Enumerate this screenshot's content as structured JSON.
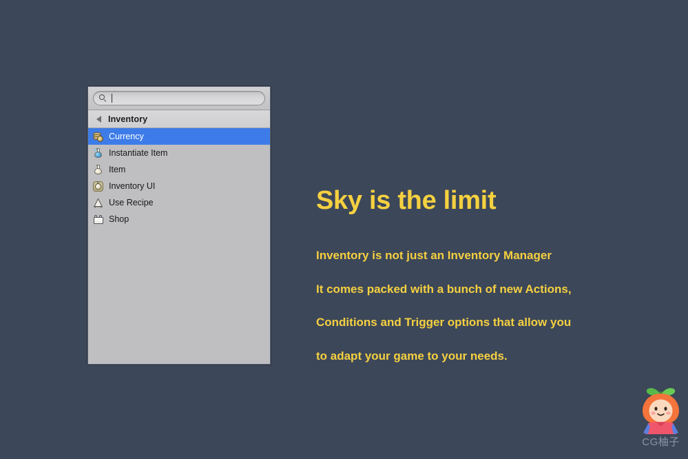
{
  "background_color": "#3c4759",
  "panel": {
    "search": {
      "icon": "search-icon",
      "value": "",
      "placeholder": ""
    },
    "header": {
      "back_icon": "back-triangle-icon",
      "title": "Inventory"
    },
    "items": [
      {
        "label": "Currency",
        "icon": "coins-icon",
        "selected": true
      },
      {
        "label": "Instantiate Item",
        "icon": "blue-flask-icon",
        "selected": false
      },
      {
        "label": "Item",
        "icon": "cream-flask-icon",
        "selected": false
      },
      {
        "label": "Inventory UI",
        "icon": "inventory-ui-icon",
        "selected": false
      },
      {
        "label": "Use Recipe",
        "icon": "recipe-alembic-icon",
        "selected": false
      },
      {
        "label": "Shop",
        "icon": "shopping-bag-icon",
        "selected": false
      }
    ],
    "selection_color": "#3d7ce8",
    "body_color": "#bfbfc2"
  },
  "copy": {
    "headline": "Sky is the limit",
    "accent_color": "#f5d040",
    "lines": [
      "Inventory is not just an Inventory Manager",
      "It comes packed with a bunch of new Actions,",
      "Conditions and Trigger options that allow you",
      "to adapt your game to your needs."
    ]
  },
  "watermark": {
    "text": "CG柚子",
    "mascot": "orange-mascot-icon",
    "text_color": "#8b95a6"
  }
}
